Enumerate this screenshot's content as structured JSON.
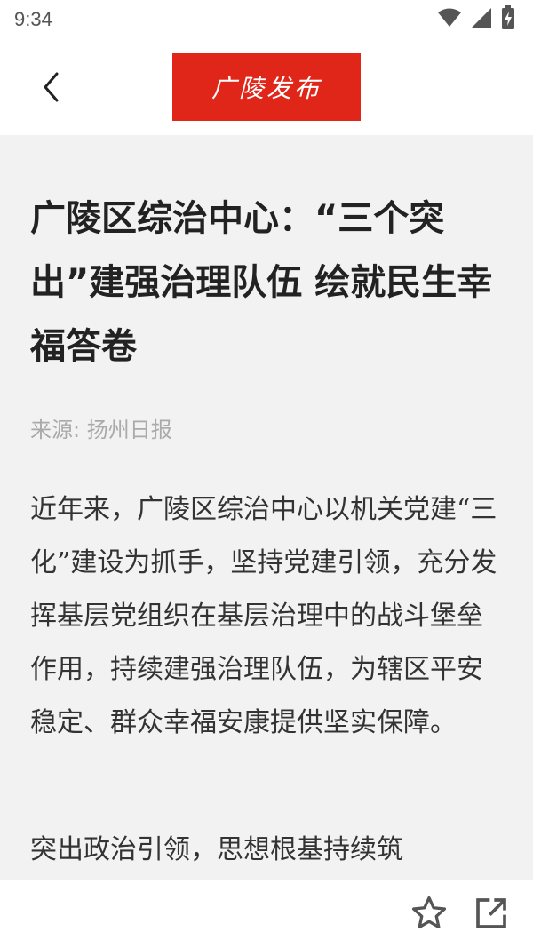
{
  "status_bar": {
    "time": "9:34",
    "icons": [
      "wifi-icon",
      "signal-icon",
      "battery-icon"
    ]
  },
  "header": {
    "back_icon": "back-arrow-icon",
    "logo_text": "广陵发布",
    "logo_color": "#e02619"
  },
  "article": {
    "title": "广陵区综治中心：“三个突出”建强治理队伍 绘就民生幸福答卷",
    "source": "来源: 扬州日报",
    "paragraphs": [
      "近年来，广陵区综治中心以机关党建“三化”建设为抓手，坚持党建引领，充分发挥基层党组织在基层治理中的战斗堡垒作用，持续建强治理队伍，为辖区平安稳定、群众幸福安康提供坚实保障。",
      "突出政治引领，思想根基持续筑"
    ]
  },
  "bottom_bar": {
    "icons": [
      "star-icon",
      "share-icon"
    ]
  }
}
